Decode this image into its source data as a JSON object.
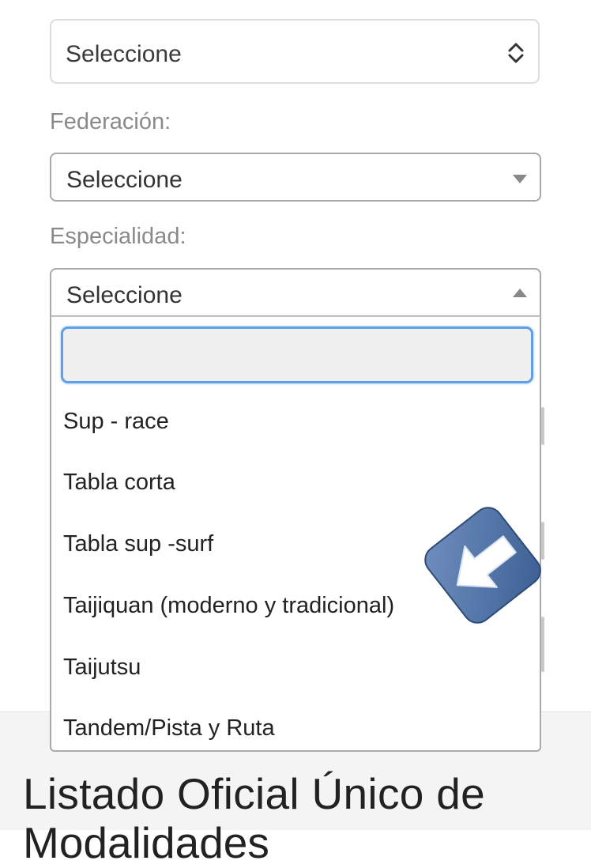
{
  "top_select": {
    "value": "Seleccione",
    "icon": "up-down-chevron-icon"
  },
  "federacion": {
    "label": "Federación:",
    "value": "Seleccione",
    "icon": "caret-down-icon"
  },
  "especialidad": {
    "label": "Especialidad:",
    "value": "Seleccione",
    "icon": "caret-up-icon",
    "search": {
      "value": "",
      "placeholder": ""
    },
    "options": [
      "Sup - race",
      "Tabla corta",
      "Tabla sup -surf",
      "Taijiquan (moderno y tradicional)",
      "Taijutsu",
      "Tandem/Pista y Ruta"
    ]
  },
  "overlay": {
    "icon": "back-arrow-icon",
    "color": "#4f72a3"
  },
  "footer": {
    "title_line1": "Listado Oficial Único de",
    "title_line2": "Modalidades"
  },
  "colors": {
    "focus_ring": "#5fa0e8",
    "label": "#8a8a8a",
    "border": "#a9a9a9"
  }
}
